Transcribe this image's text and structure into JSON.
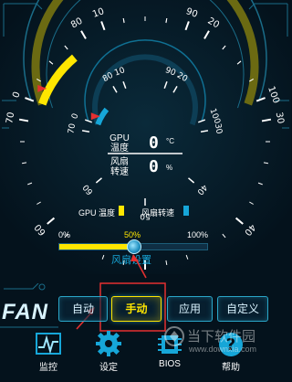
{
  "gauge": {
    "outer_ticks": [
      "0",
      "10",
      "20",
      "30",
      "40",
      "50",
      "60",
      "70",
      "80",
      "90",
      "100"
    ],
    "inner_ticks": [
      "0",
      "10",
      "20",
      "30",
      "40",
      "50",
      "60",
      "70",
      "80",
      "90",
      "100"
    ],
    "gpu_temp_label_1": "GPU",
    "gpu_temp_label_2": "温度",
    "gpu_temp_value": "0",
    "gpu_temp_unit": "°C",
    "fan_speed_label_1": "风扇",
    "fan_speed_label_2": "转速",
    "fan_speed_value": "0",
    "fan_speed_unit": "%",
    "legend_gpu": "GPU 温度",
    "legend_fan": "风扇转速",
    "colors": {
      "gpu": "#ffe600",
      "fan": "#16a6d8",
      "ring": "#6b6a12"
    }
  },
  "fan_slider": {
    "min_label": "0%",
    "mid_label": "50%",
    "max_label": "100%",
    "value_percent": 50,
    "title": "风扇设置"
  },
  "brand": {
    "logo_text": "FAN"
  },
  "mode_buttons": [
    {
      "label": "自动"
    },
    {
      "label": "手动"
    },
    {
      "label": "应用"
    },
    {
      "label": "自定义"
    }
  ],
  "nav": [
    {
      "label": "监控",
      "icon": "monitor-icon"
    },
    {
      "label": "设定",
      "icon": "gear-icon"
    },
    {
      "label": "BIOS",
      "icon": "bios-chip-icon"
    },
    {
      "label": "帮助",
      "icon": "help-icon"
    }
  ],
  "watermark": {
    "text": "当下软件园",
    "sub": "www.downxia.com"
  }
}
